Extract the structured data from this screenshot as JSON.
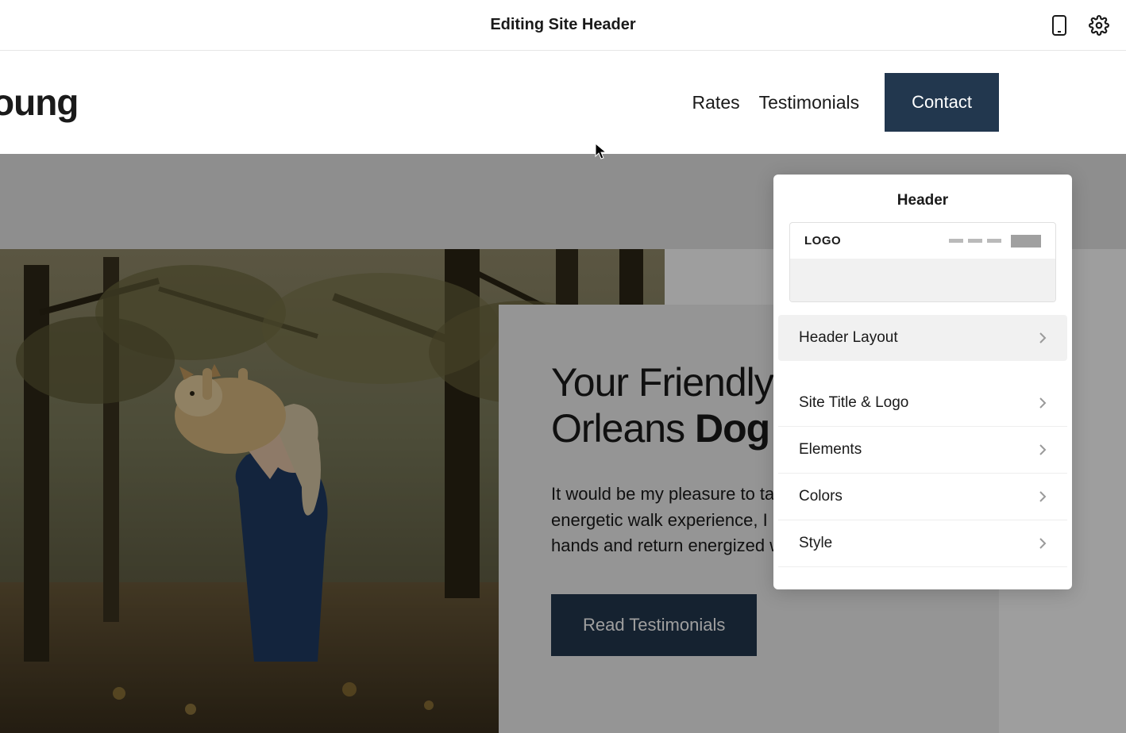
{
  "editor": {
    "title": "Editing Site Header"
  },
  "siteHeader": {
    "title": "oung",
    "nav": {
      "rates": "Rates",
      "testimonials": "Testimonials",
      "contact": "Contact"
    }
  },
  "hero": {
    "headingLight1": "Your Friendly ",
    "headingLight2": "Orleans ",
    "headingBold": "Dog W",
    "description": "It would be my pleasure to tak member on an energetic walk experience, I promise your dog hands and return energized w",
    "buttonLabel": "Read Testimonials"
  },
  "panel": {
    "title": "Header",
    "logoLabel": "LOGO",
    "items": {
      "layout": "Header Layout",
      "titleLogo": "Site Title & Logo",
      "elements": "Elements",
      "colors": "Colors",
      "style": "Style"
    }
  }
}
